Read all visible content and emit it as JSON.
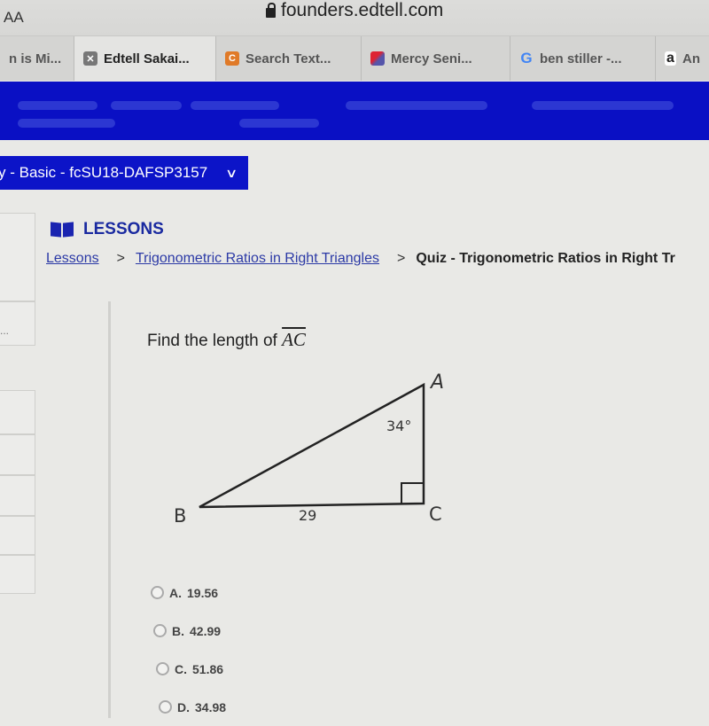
{
  "browser": {
    "text_size_control": "AA",
    "url": "founders.edtell.com",
    "tabs": [
      {
        "label": "n is Mi...",
        "icon": "none",
        "active": false
      },
      {
        "label": "Edtell Sakai...",
        "icon": "close-x-favicon",
        "active": true
      },
      {
        "label": "Search Text...",
        "icon": "c-favicon",
        "active": false
      },
      {
        "label": "Mercy Seni...",
        "icon": "mercy-favicon",
        "active": false
      },
      {
        "label": "ben stiller -...",
        "icon": "google-favicon",
        "active": false
      },
      {
        "label": "An",
        "icon": "amazon-favicon",
        "active": false
      }
    ]
  },
  "course_selector": {
    "label": "y - Basic - fcSU18-DAFSP3157",
    "chevron": "chevron-down-icon"
  },
  "lessons": {
    "heading": "LESSONS",
    "icon": "book-icon",
    "breadcrumb": {
      "items": [
        "Lessons",
        "Trigonometric Ratios in Right Triangles"
      ],
      "separator": ">",
      "current": "Quiz - Trigonometric Ratios in Right Tr"
    }
  },
  "sidebar": {
    "truncated_text": "..."
  },
  "question": {
    "prompt": "Find the length of ",
    "segment": "AC",
    "figure": {
      "vertices": {
        "A": "A",
        "B": "B",
        "C": "C"
      },
      "angle_label": "34°",
      "side_label": "29",
      "right_angle_at": "C"
    },
    "choices": [
      {
        "letter": "A.",
        "value": "19.56"
      },
      {
        "letter": "B.",
        "value": "42.99"
      },
      {
        "letter": "C.",
        "value": "51.86"
      },
      {
        "letter": "D.",
        "value": "34.98"
      }
    ]
  },
  "colors": {
    "banner_blue": "#0a10c4",
    "link_blue": "#2c3aa6",
    "heading_blue": "#1a2aa0"
  }
}
